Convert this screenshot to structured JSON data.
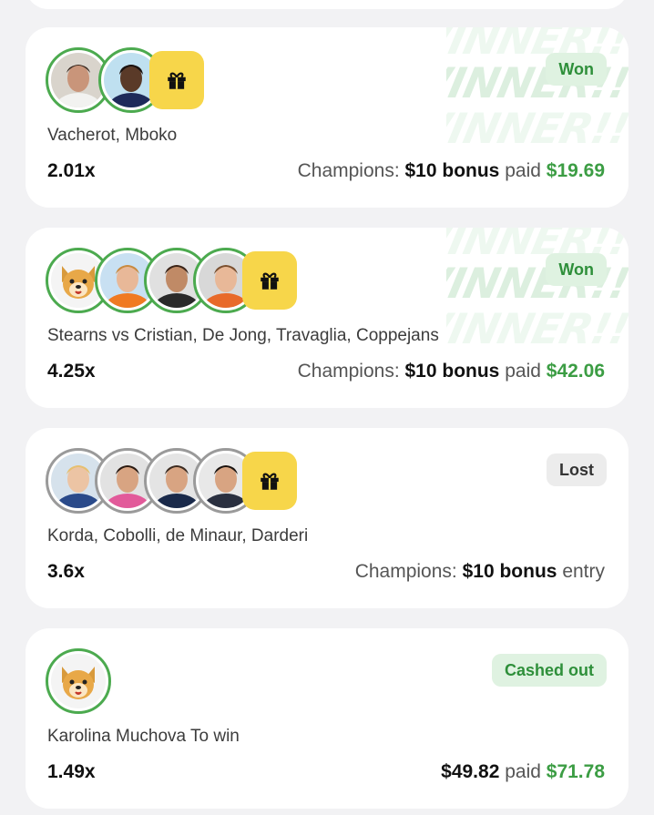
{
  "cards": [
    {
      "players": "Vacherot, Mboko",
      "multiplier": "2.01x",
      "status": "Won",
      "background_text": "WINNER!!",
      "payout": {
        "prefix": "Champions:",
        "amount": "$10 bonus",
        "middle": "paid",
        "result": "$19.69"
      },
      "avatars": [
        "player-photo",
        "player-photo"
      ],
      "has_gift": true
    },
    {
      "players": "Stearns vs Cristian, De Jong, Travaglia, Coppejans",
      "multiplier": "4.25x",
      "status": "Won",
      "background_text": "WINNER!!",
      "payout": {
        "prefix": "Champions:",
        "amount": "$10 bonus",
        "middle": "paid",
        "result": "$42.06"
      },
      "avatars": [
        "dog-mascot",
        "player-photo",
        "player-photo",
        "player-photo"
      ],
      "has_gift": true
    },
    {
      "players": "Korda, Cobolli, de Minaur, Darderi",
      "multiplier": "3.6x",
      "status": "Lost",
      "payout": {
        "prefix": "Champions:",
        "amount": "$10 bonus",
        "middle": "entry",
        "result": ""
      },
      "avatars": [
        "player-photo",
        "player-photo",
        "player-photo",
        "player-photo"
      ],
      "has_gift": true
    },
    {
      "players": "Karolina Muchova To win",
      "multiplier": "1.49x",
      "status": "Cashed out",
      "payout": {
        "prefix": "",
        "amount": "$49.82",
        "middle": "paid",
        "result": "$71.78"
      },
      "avatars": [
        "dog-mascot"
      ],
      "has_gift": false
    }
  ],
  "colors": {
    "won_green": "#3c9d44",
    "avatar_ring_win": "#4caa4f",
    "avatar_ring_lost": "#9a9a9a",
    "gift_yellow": "#f7d64a"
  }
}
